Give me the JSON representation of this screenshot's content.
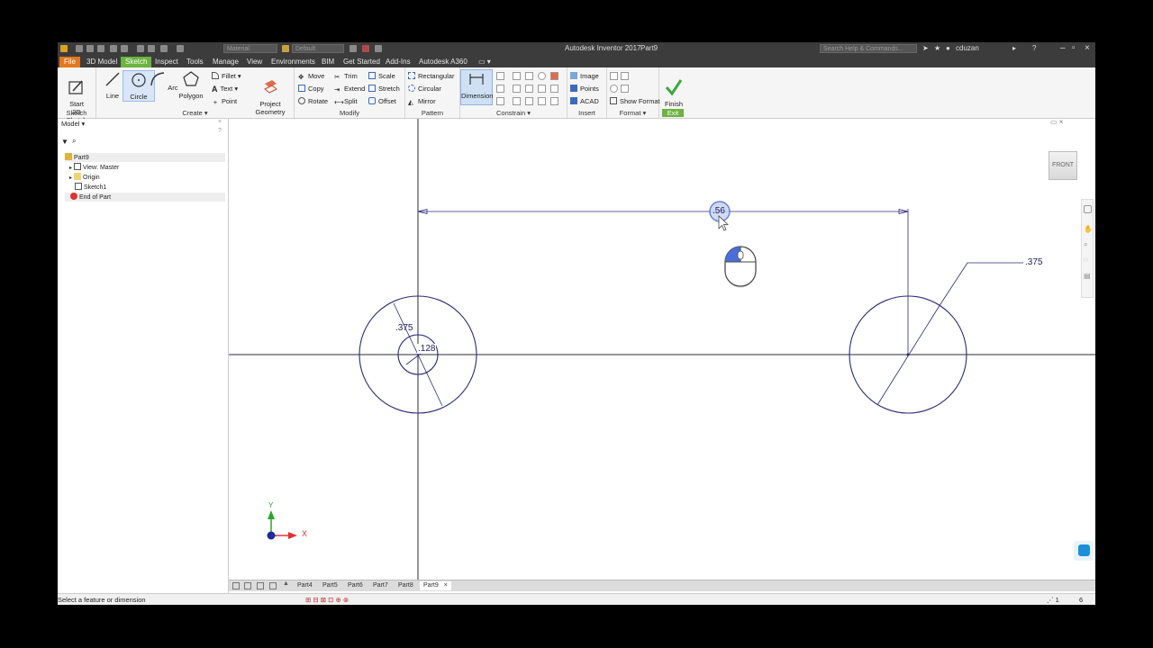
{
  "titlebar": {
    "app_title": "Autodesk Inventor 2017",
    "doc_name": "Part9",
    "material": "Material",
    "appearance": "Default",
    "search_placeholder": "Search Help & Commands...",
    "user": "cduzan"
  },
  "tabs": [
    "File",
    "3D Model",
    "Sketch",
    "Inspect",
    "Tools",
    "Manage",
    "View",
    "Environments",
    "BIM",
    "Get Started",
    "Add-Ins",
    "Autodesk A360"
  ],
  "active_tab": "Sketch",
  "ribbon": {
    "sketch": {
      "start": "Start\n2D Sketch",
      "label": "Sketch"
    },
    "create": {
      "line": "Line",
      "circle": "Circle",
      "arc": "Arc",
      "polygon": "Polygon",
      "fillet": "Fillet",
      "text": "Text",
      "point": "Point",
      "project": "Project\nGeometry",
      "label": "Create"
    },
    "modify": {
      "move": "Move",
      "trim": "Trim",
      "scale": "Scale",
      "copy": "Copy",
      "extend": "Extend",
      "stretch": "Stretch",
      "rotate": "Rotate",
      "split": "Split",
      "offset": "Offset",
      "label": "Modify"
    },
    "pattern": {
      "rectangular": "Rectangular",
      "circular": "Circular",
      "mirror": "Mirror",
      "label": "Pattern"
    },
    "constrain": {
      "dimension": "Dimension",
      "label": "Constrain"
    },
    "insert": {
      "image": "Image",
      "points": "Points",
      "acad": "ACAD",
      "label": "Insert"
    },
    "format": {
      "show_format": "Show Format",
      "label": "Format"
    },
    "exit": {
      "finish": "Finish\nSketch",
      "label": "Exit"
    }
  },
  "browser": {
    "title": "Model",
    "nodes": [
      "Part9",
      "View: Master",
      "Origin",
      "Sketch1",
      "End of Part"
    ]
  },
  "viewcube": {
    "face": "FRONT"
  },
  "sketch": {
    "dim_horizontal": ".56",
    "dim_left_outer": ".375",
    "dim_left_inner": ".128",
    "dim_right": ".375"
  },
  "axis": {
    "x": "X",
    "y": "Y"
  },
  "doc_tabs": [
    "Part4",
    "Part5",
    "Part6",
    "Part7",
    "Part8",
    "Part9"
  ],
  "active_doc": "Part9",
  "status": {
    "message": "Select a feature or dimension",
    "count_a": "1",
    "count_b": "6"
  },
  "colors": {
    "file_tab": "#e5771e",
    "active_tab": "#6cb33f",
    "sketch_geometry": "#2b2b7a",
    "dimension_highlight": "#4a6fd8"
  }
}
